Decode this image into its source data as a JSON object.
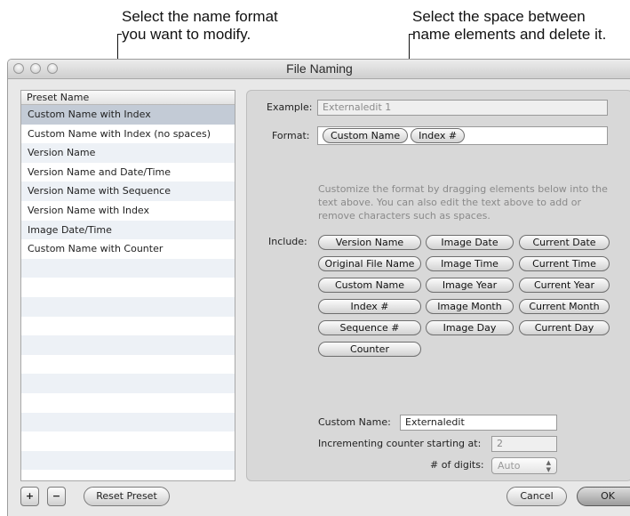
{
  "callouts": {
    "left": [
      "Select the name format",
      "you want to modify."
    ],
    "right": [
      "Select the space between",
      "name elements and delete it."
    ]
  },
  "window": {
    "title": "File Naming"
  },
  "preset_list": {
    "header": "Preset Name",
    "selected_index": 0,
    "items": [
      "Custom Name with Index",
      "Custom Name with Index (no spaces)",
      "Version Name",
      "Version Name and Date/Time",
      "Version Name with Sequence",
      "Version Name with Index",
      "Image Date/Time",
      "Custom Name with Counter"
    ]
  },
  "panel": {
    "example_label": "Example:",
    "example_value": "Externaledit 1",
    "format_label": "Format:",
    "format_tokens": [
      "Custom Name",
      "Index #"
    ],
    "help_text": "Customize the format by dragging elements below into the text above. You can also edit the text above to add or remove characters such as spaces.",
    "include_label": "Include:",
    "include_tokens": [
      [
        "Version Name",
        "Image Date",
        "Current Date"
      ],
      [
        "Original File Name",
        "Image Time",
        "Current Time"
      ],
      [
        "Custom Name",
        "Image Year",
        "Current Year"
      ],
      [
        "Index #",
        "Image Month",
        "Current Month"
      ],
      [
        "Sequence #",
        "Image Day",
        "Current Day"
      ],
      [
        "Counter"
      ]
    ],
    "custom_name_label": "Custom Name:",
    "custom_name_value": "Externaledit",
    "counter_label": "Incrementing counter starting at:",
    "counter_value": "2",
    "digits_label": "# of digits:",
    "digits_value": "Auto"
  },
  "footer": {
    "add_label": "+",
    "remove_label": "−",
    "reset_label": "Reset Preset",
    "cancel_label": "Cancel",
    "ok_label": "OK"
  }
}
